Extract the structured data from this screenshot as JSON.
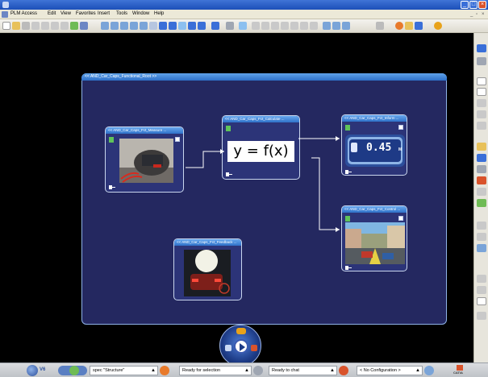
{
  "menu": {
    "items": [
      "PLM Access",
      "Edit",
      "View",
      "Favorites",
      "Insert",
      "Tools",
      "Window",
      "Help"
    ]
  },
  "workspace": {
    "main_block": {
      "title": "<< AND_Car_Caps_Functional_Root >>"
    },
    "blocks": [
      {
        "title": "<< AND_Car_Caps_Fct_Measure ...",
        "image": "car-rear-parking-sensor"
      },
      {
        "title": "<< AND_Car_Caps_Fct_Calculate ...",
        "formula": "y = f(x)"
      },
      {
        "title": "<< AND_Car_Caps_Fct_Inform ...",
        "image": "dashboard-display",
        "display_value": "0.45",
        "display_unit": "M"
      },
      {
        "title": "<< AND_Car_Caps_Fct_Control ...",
        "image": "street-view-camera"
      },
      {
        "title": "<< AND_Car_Caps_Fct_Feedback ...",
        "image": "car-reversing-lights"
      }
    ]
  },
  "status": {
    "specfield": "spec \"Structure\"",
    "selection": "Ready for selection",
    "chat": "Ready to chat",
    "config": "< No Configuration >",
    "version": "V6",
    "brand": "CATIA"
  },
  "colors": {
    "canvas_bg": "#000000",
    "block_bg": "#242860",
    "header_blue": "#3b7fd6",
    "connector": "#ffffff"
  }
}
